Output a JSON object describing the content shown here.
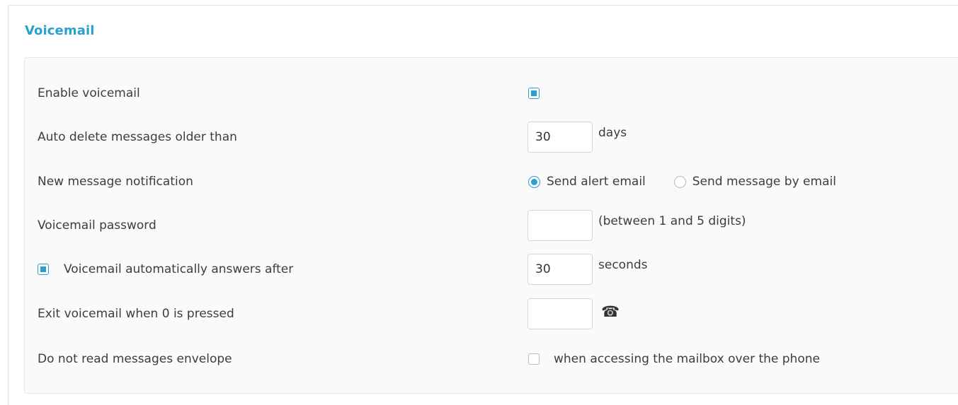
{
  "section": {
    "title": "Voicemail"
  },
  "rows": {
    "enable_voicemail": {
      "label": "Enable voicemail",
      "checked": true
    },
    "auto_delete": {
      "label": "Auto delete messages older than",
      "value": "30",
      "suffix": "days"
    },
    "notification": {
      "label": "New message notification",
      "options": [
        {
          "label": "Send alert email",
          "selected": true
        },
        {
          "label": "Send message by email",
          "selected": false
        }
      ]
    },
    "password": {
      "label": "Voicemail password",
      "value": "",
      "suffix": "(between 1 and 5 digits)"
    },
    "auto_answer": {
      "label": "Voicemail automatically answers after",
      "checked": true,
      "value": "30",
      "suffix": "seconds"
    },
    "exit_on_zero": {
      "label": "Exit voicemail when 0 is pressed",
      "value": "",
      "icon": "phone-icon",
      "icon_glyph": "☎"
    },
    "envelope": {
      "label": "Do not read messages envelope",
      "checked": false,
      "text": "when accessing the mailbox over the phone"
    }
  },
  "colors": {
    "accent": "#2a9fd0",
    "text": "#3d3d3d",
    "panel_bg": "#fafafa",
    "border": "#e6e6e6"
  }
}
